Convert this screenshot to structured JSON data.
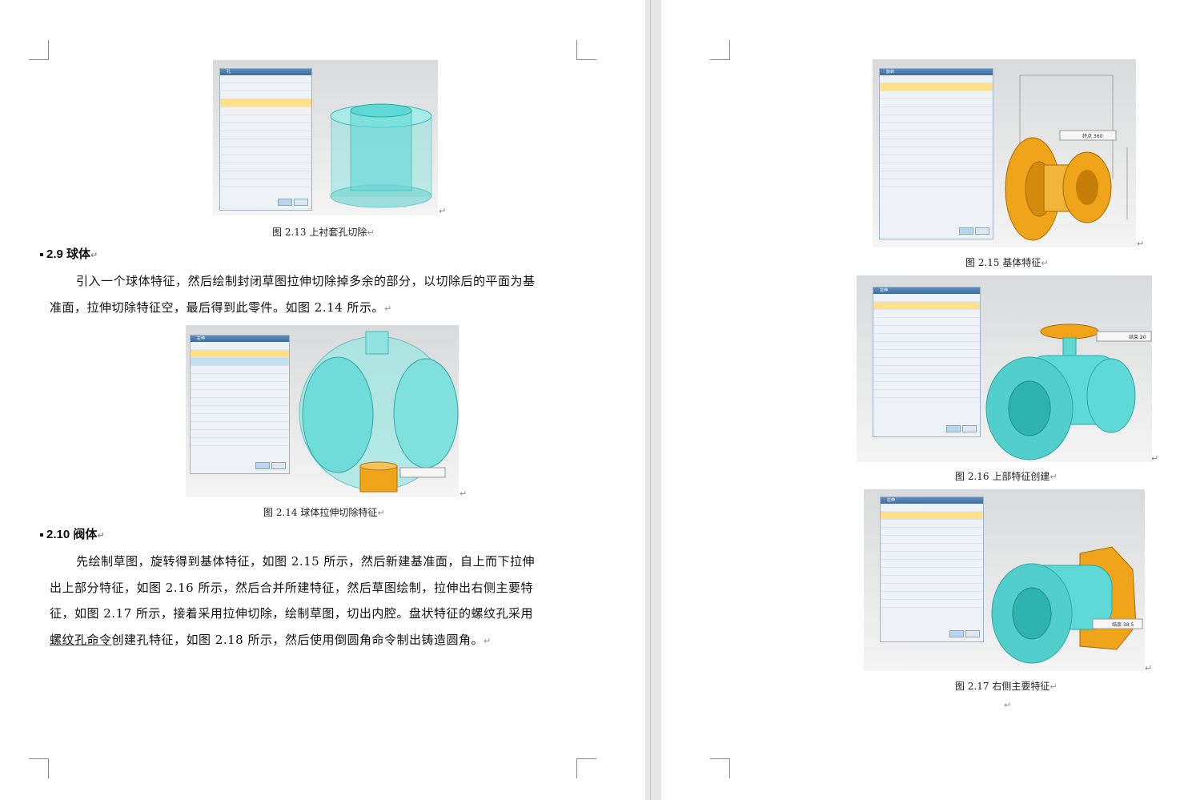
{
  "left_page": {
    "figures": [
      {
        "id": "fig-2-13",
        "caption": "图 2.13  上衬套孔切除",
        "panel_title": "孔"
      },
      {
        "id": "fig-2-14",
        "caption": "图 2.14  球体拉伸切除特征",
        "panel_title": "拉伸"
      }
    ],
    "sections": [
      {
        "heading": "2.9 球体",
        "lines": [
          "引入一个球体特征，然后绘制封闭草图拉伸切除掉多余的部分，以切除后的平面为基",
          "准面，拉伸切除特征空，最后得到此零件。如图 2.14 所示。"
        ]
      },
      {
        "heading": "2.10 阀体",
        "lines": [
          "先绘制草图，旋转得到基体特征，如图 2.15 所示，然后新建基准面，自上而下拉伸",
          "出上部分特征，如图 2.16 所示，然后合并所建特征，然后草图绘制，拉伸出右侧主要特",
          "征，如图 2.17 所示，接着采用拉伸切除，绘制草图，切出内腔。盘状特征的螺纹孔采用"
        ],
        "last_line_link": "螺纹孔命令",
        "last_line_rest": "创建孔特征，如图 2.18 所示，然后使用倒圆角命令制出铸造圆角。"
      }
    ]
  },
  "right_page": {
    "figures": [
      {
        "id": "fig-2-15",
        "caption": "图 2.15  基体特征",
        "panel_title": "旋转",
        "readout": "终点 360"
      },
      {
        "id": "fig-2-16",
        "caption": "图 2.16  上部特征创建",
        "panel_title": "拉伸",
        "readout": "结束 20"
      },
      {
        "id": "fig-2-17",
        "caption": "图 2.17  右侧主要特征",
        "panel_title": "拉伸",
        "readout": "结束 38.5"
      }
    ]
  },
  "marks": {
    "return": "↵"
  },
  "colors": {
    "cyan": "#5fd9d6",
    "orange": "#f0a419",
    "panel": "#eef2f6"
  }
}
